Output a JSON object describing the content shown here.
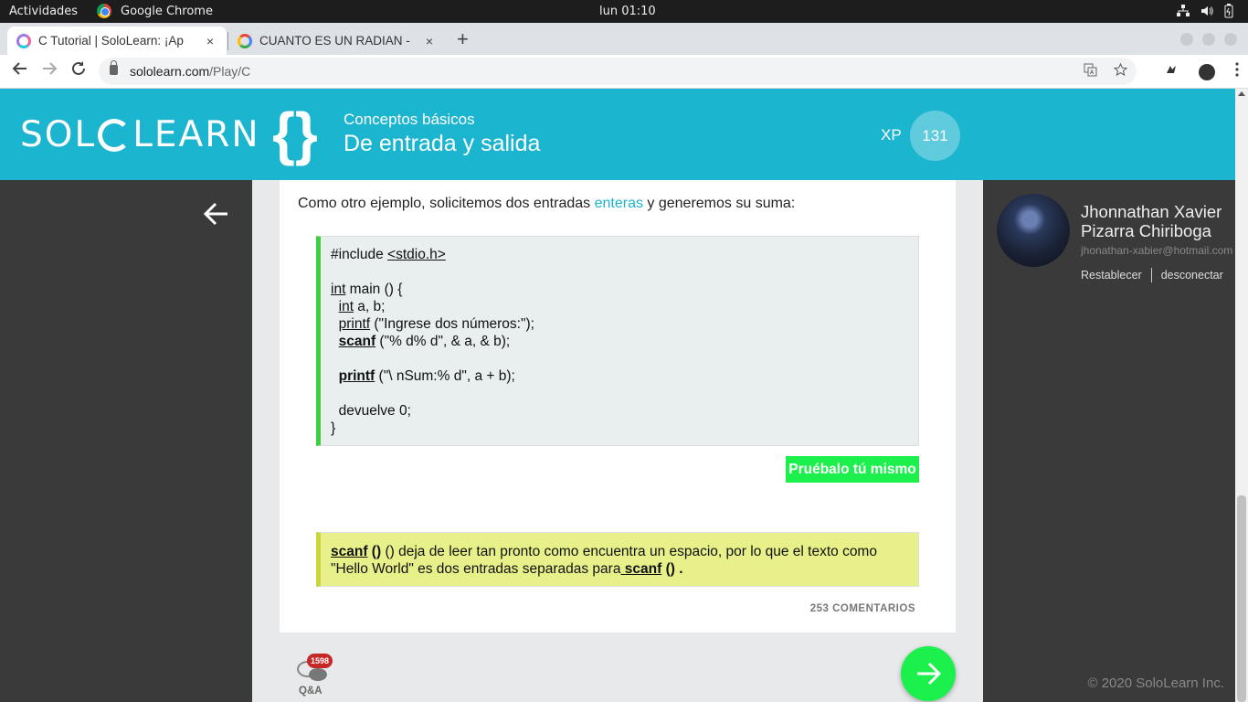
{
  "system": {
    "activities": "Actividades",
    "app_name": "Google Chrome",
    "clock": "lun 01:10"
  },
  "tabs": [
    {
      "title": "C Tutorial | SoloLearn: ¡Ap",
      "close": "×"
    },
    {
      "title": "CUANTO ES UN RADIAN -",
      "close": "×"
    }
  ],
  "new_tab": "+",
  "address": {
    "domain": "sololearn.com",
    "path": "/Play/C"
  },
  "header": {
    "logo_left": "SOL",
    "logo_right": "LEARN",
    "braces": "{}",
    "subtitle": "Conceptos básicos",
    "title": "De entrada y salida",
    "xp_label": "XP",
    "xp_value": "131"
  },
  "lesson": {
    "intro_before": "Como otro ejemplo, solicitemos dos entradas ",
    "intro_keyword": "enteras",
    "intro_after": " y generemos su suma:",
    "code": {
      "l1_a": "#include ",
      "l1_b": "<stdio.h>",
      "l3_a": "int",
      "l3_b": " main () {",
      "l4_a": "  ",
      "l4_b": "int",
      "l4_c": " a, b;",
      "l5_a": "  ",
      "l5_b": "printf",
      "l5_c": " (\"Ingrese dos números:\");",
      "l6_a": "  ",
      "l6_b": "scanf",
      "l6_c": " (\"% d% d\", & a, & b);",
      "l8_a": "  ",
      "l8_b": "printf",
      "l8_c": " (\"\\ nSum:% d\", a + b);",
      "l10": "  devuelve 0;",
      "l11": "}"
    },
    "try_button": "Pruébalo tú mismo",
    "note": {
      "kw1": "scanf",
      "p1": " () deja de leer tan pronto como encuentra un espacio, por lo que el texto como \"Hello World\" es dos entradas separadas para",
      "kw2": " scanf",
      "p2": " () ."
    },
    "comments": "253 COMENTARIOS"
  },
  "qa": {
    "badge": "1598",
    "label": "Q&A"
  },
  "user": {
    "name": "Jhonnathan Xavier Pizarra Chiriboga",
    "email": "jhonathan-xabier@hotmail.com",
    "reset": "Restablecer",
    "logout": "desconectar"
  },
  "footer": {
    "copyright": "© 2020 SoloLearn Inc."
  },
  "colors": {
    "brand": "#1cb5cf",
    "success": "#1cf04c",
    "note": "#e8f089"
  }
}
